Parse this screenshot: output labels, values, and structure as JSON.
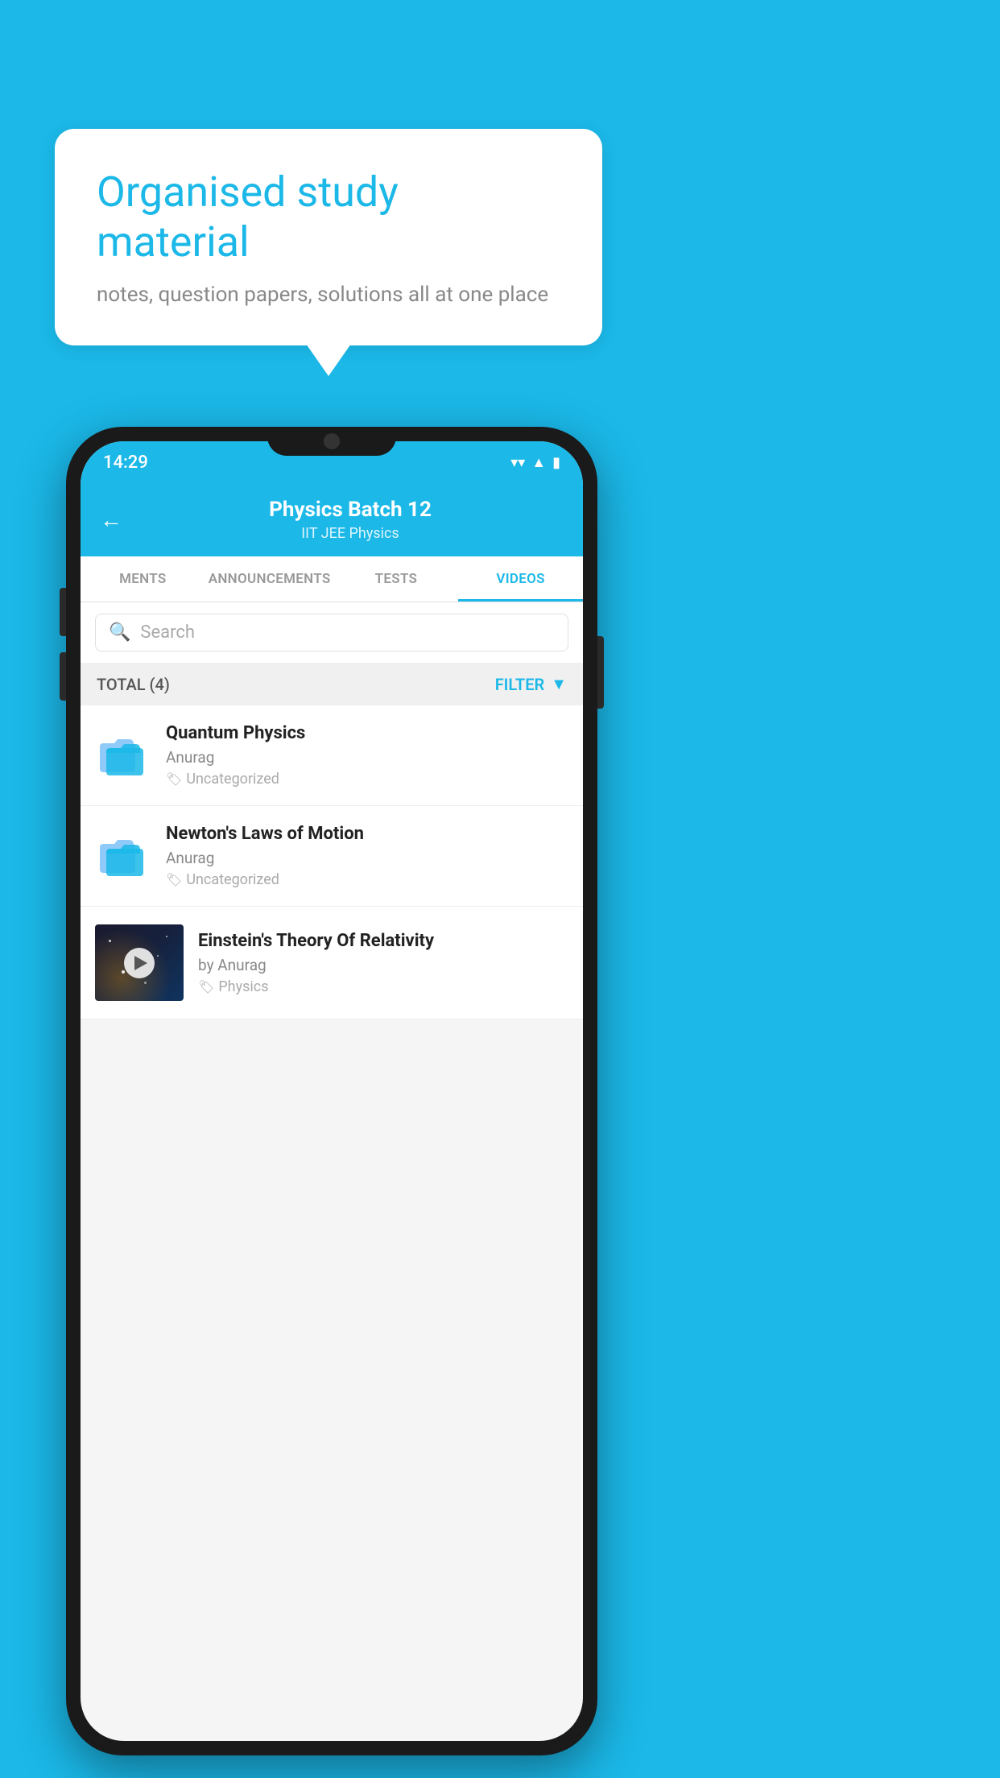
{
  "background": {
    "color": "#1BB8E8"
  },
  "speech_bubble": {
    "title": "Organised study material",
    "subtitle": "notes, question papers, solutions all at one place"
  },
  "phone": {
    "status_bar": {
      "time": "14:29",
      "icons": [
        "wifi",
        "signal",
        "battery"
      ]
    },
    "header": {
      "back_label": "←",
      "title": "Physics Batch 12",
      "breadcrumb_part1": "IIT JEE",
      "breadcrumb_sep": "  ",
      "breadcrumb_part2": "Physics"
    },
    "tabs": [
      {
        "label": "MENTS",
        "active": false
      },
      {
        "label": "ANNOUNCEMENTS",
        "active": false
      },
      {
        "label": "TESTS",
        "active": false
      },
      {
        "label": "VIDEOS",
        "active": true
      }
    ],
    "search": {
      "placeholder": "Search"
    },
    "filter_bar": {
      "total_label": "TOTAL (4)",
      "filter_label": "FILTER"
    },
    "videos": [
      {
        "id": 1,
        "title": "Quantum Physics",
        "author": "Anurag",
        "tag": "Uncategorized",
        "type": "folder",
        "has_thumb": false
      },
      {
        "id": 2,
        "title": "Newton's Laws of Motion",
        "author": "Anurag",
        "tag": "Uncategorized",
        "type": "folder",
        "has_thumb": false
      },
      {
        "id": 3,
        "title": "Einstein's Theory Of Relativity",
        "author": "by Anurag",
        "tag": "Physics",
        "type": "video",
        "has_thumb": true
      }
    ]
  }
}
